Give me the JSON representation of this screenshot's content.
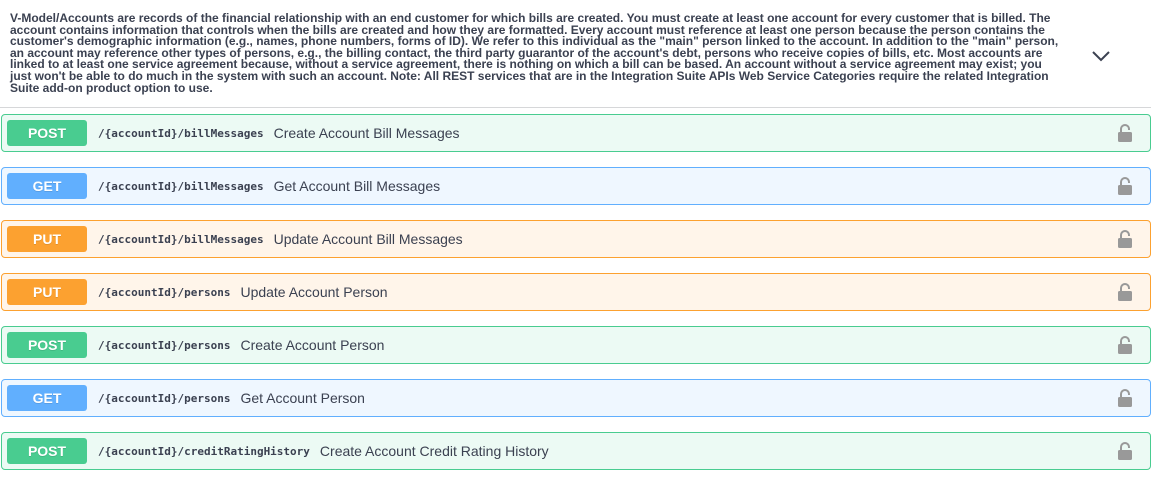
{
  "tag": {
    "description": "V-Model/Accounts are records of the financial relationship with an end customer for which bills are created. You must create at least one account for every customer that is billed. The account contains information that controls when the bills are created and how they are formatted. Every account must reference at least one person because the person contains the customer's demographic information (e.g., names, phone numbers, forms of ID). We refer to this individual as the \"main\" person linked to the account. In addition to the \"main\" person, an account may reference other types of persons, e.g., the billing contact, the third party guarantor of the account's debt, persons who receive copies of bills, etc. Most accounts are linked to at least one service agreement because, without a service agreement, there is nothing on which a bill can be based. An account without a service agreement may exist; you just won't be able to do much in the system with such an account. Note: All REST services that are in the Integration Suite APIs Web Service Categories require the related Integration Suite add-on product option to use.",
    "toggle_icon": "chevron-down-icon"
  },
  "operations": [
    {
      "method": "POST",
      "path": "/{accountId}/billMessages",
      "summary": "Create Account Bill Messages",
      "color": "#49cc90",
      "icon": "lock-icon"
    },
    {
      "method": "GET",
      "path": "/{accountId}/billMessages",
      "summary": "Get Account Bill Messages",
      "color": "#61affe",
      "icon": "lock-icon"
    },
    {
      "method": "PUT",
      "path": "/{accountId}/billMessages",
      "summary": "Update Account Bill Messages",
      "color": "#fca130",
      "icon": "lock-icon"
    },
    {
      "method": "PUT",
      "path": "/{accountId}/persons",
      "summary": "Update Account Person",
      "color": "#fca130",
      "icon": "lock-icon"
    },
    {
      "method": "POST",
      "path": "/{accountId}/persons",
      "summary": "Create Account Person",
      "color": "#49cc90",
      "icon": "lock-icon"
    },
    {
      "method": "GET",
      "path": "/{accountId}/persons",
      "summary": "Get Account Person",
      "color": "#61affe",
      "icon": "lock-icon"
    },
    {
      "method": "POST",
      "path": "/{accountId}/creditRatingHistory",
      "summary": "Create Account Credit Rating History",
      "color": "#49cc90",
      "icon": "lock-icon"
    }
  ]
}
